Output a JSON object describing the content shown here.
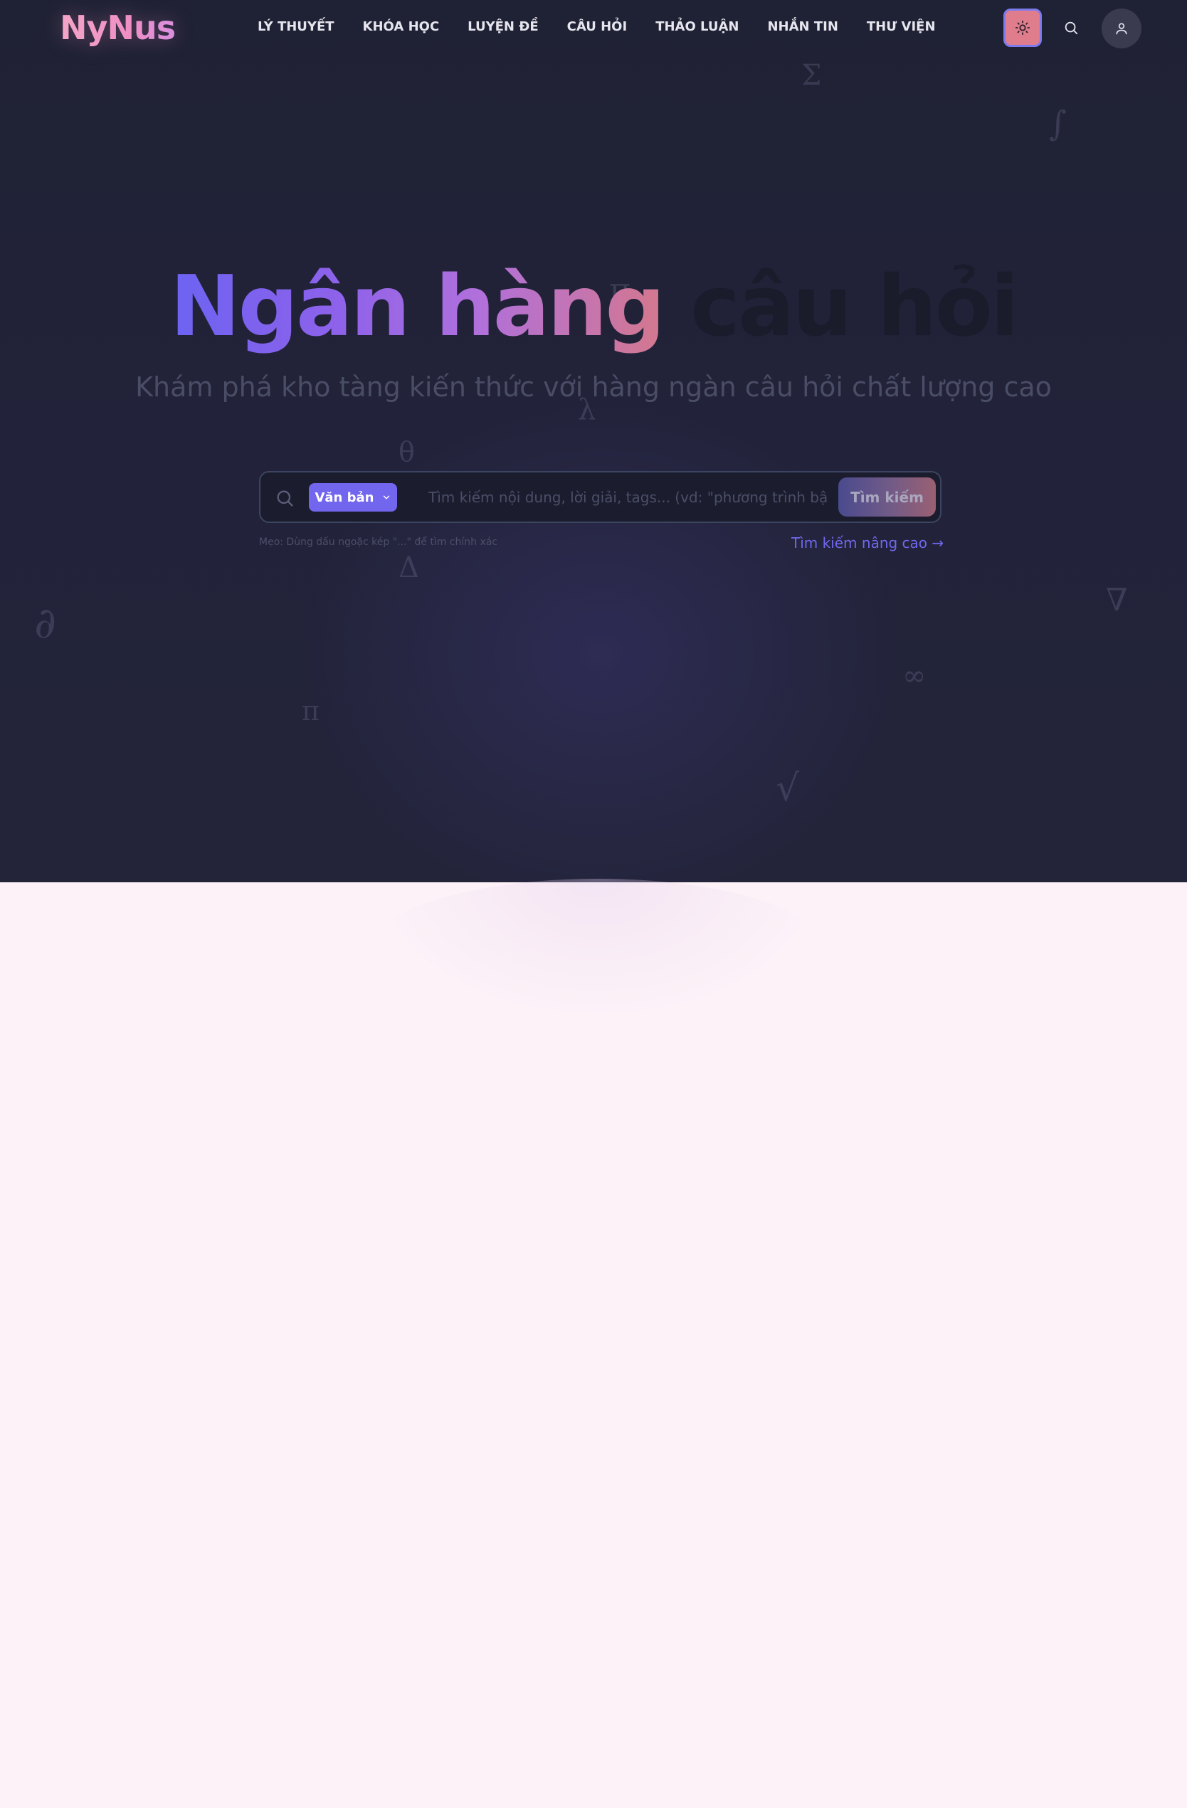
{
  "header": {
    "logo": "NyNus",
    "nav": [
      {
        "label": "LÝ THUYẾT"
      },
      {
        "label": "KHÓA HỌC"
      },
      {
        "label": "LUYỆN ĐỀ"
      },
      {
        "label": "CÂU HỎI"
      },
      {
        "label": "THẢO LUẬN"
      },
      {
        "label": "NHẮN TIN"
      },
      {
        "label": "THƯ VIỆN"
      }
    ],
    "icons": {
      "theme": "sun-icon",
      "search": "search-icon",
      "user": "user-icon"
    }
  },
  "hero": {
    "title_gradient": "Ngân hàng",
    "title_plain": "câu hỏi",
    "subtitle": "Khám phá kho tàng kiến thức với hàng ngàn câu hỏi chất lượng cao",
    "symbols": [
      "Σ",
      "∫",
      "π",
      "λ",
      "θ",
      "Δ",
      "∂",
      "∇",
      "∞",
      "√"
    ]
  },
  "search": {
    "type_label": "Văn bản",
    "placeholder": "Tìm kiếm nội dung, lời giải, tags... (vd: \"phương trình bậc hai\")",
    "value": "",
    "submit_label": "Tìm kiếm",
    "tip": "Mẹo: Dùng dấu ngoặc kép \"...\" để tìm chính xác",
    "advanced_link": "Tìm kiếm nâng cao →"
  },
  "colors": {
    "hero_bg": "#1f2134",
    "page_bg": "#fdf2f8",
    "accent": "#7265ee",
    "theme_button": "#df7d8c"
  }
}
